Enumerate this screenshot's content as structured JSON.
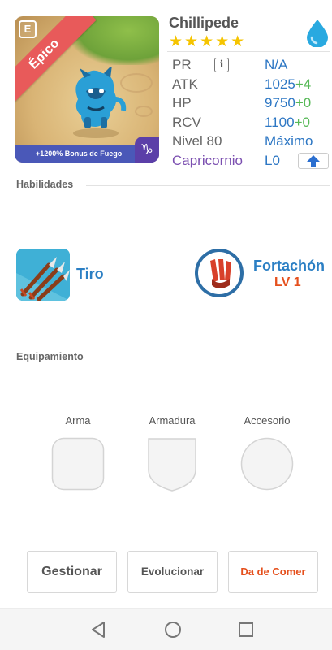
{
  "monster": {
    "name": "Chillipede",
    "stars": "★★★★★",
    "rarity_label": "Épico",
    "rarity_badge": "E",
    "bonus_text": "+1200% Bonus de Fuego",
    "sign_symbol": "♑"
  },
  "stats": [
    {
      "label": "PR",
      "value": "N/A",
      "bonus": ""
    },
    {
      "label": "ATK",
      "value": "1025",
      "bonus": "+4"
    },
    {
      "label": "HP",
      "value": "9750",
      "bonus": "+0"
    },
    {
      "label": "RCV",
      "value": "1100",
      "bonus": "+0"
    },
    {
      "label": "Nivel 80",
      "value": "Máximo",
      "bonus": ""
    },
    {
      "label": "Capricornio",
      "value": "L0",
      "bonus": ""
    }
  ],
  "stats_info_glyph": "i",
  "sections": {
    "abilities_title": "Habilidades",
    "equipment_title": "Equipamiento"
  },
  "skills": [
    {
      "name": "Tiro",
      "level": ""
    },
    {
      "name": "Fortachón",
      "level": "LV 1"
    }
  ],
  "equipment": {
    "weapon_label": "Arma",
    "armor_label": "Armadura",
    "accessory_label": "Accesorio"
  },
  "actions": {
    "manage_label": "Gestionar",
    "evolve_label": "Evolucionar",
    "feed_label": "Da de Comer"
  },
  "colors": {
    "accent_blue": "#2d77c4",
    "accent_green": "#57b957",
    "rarity_red": "#e85a5a",
    "feed_orange": "#e5501d",
    "sign_purple": "#7b4fb0",
    "star_gold": "#f5c400"
  },
  "icons": {
    "element": "water-drop-icon",
    "back": "back-triangle-icon",
    "home": "home-circle-icon",
    "recents": "recents-square-icon",
    "upgrade": "arrow-up-icon"
  }
}
